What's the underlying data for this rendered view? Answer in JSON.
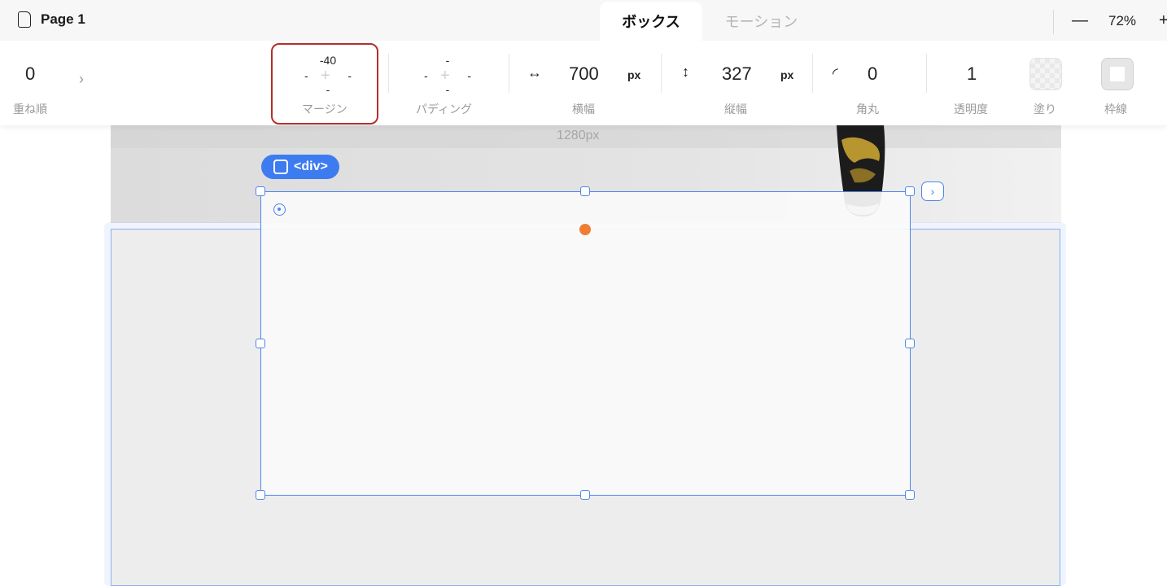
{
  "header": {
    "page_name": "Page 1",
    "tabs": [
      {
        "label": "ボックス",
        "active": true
      },
      {
        "label": "モーション",
        "active": false
      }
    ],
    "zoom": {
      "minus": "—",
      "value": "72%",
      "plus": "+"
    }
  },
  "properties": {
    "z_order": {
      "value": "0",
      "label": "重ね順",
      "chevron": "›"
    },
    "margin": {
      "top": "-40",
      "left": "-",
      "right": "-",
      "bottom": "-",
      "center": "+",
      "label": "マージン"
    },
    "padding": {
      "top": "-",
      "left": "-",
      "right": "-",
      "bottom": "-",
      "center": "+",
      "label": "パディング"
    },
    "width": {
      "icon": "↔",
      "value": "700",
      "unit": "px",
      "label": "横幅"
    },
    "height": {
      "icon": "↕",
      "value": "327",
      "unit": "px",
      "label": "縦幅"
    },
    "radius": {
      "icon": "◜",
      "value": "0",
      "label": "角丸"
    },
    "opacity": {
      "value": "1",
      "label": "透明度"
    },
    "fill": {
      "label": "塗り",
      "icon": "checker-swatch-icon"
    },
    "border": {
      "label": "枠線",
      "icon": "square-swatch-icon"
    }
  },
  "canvas": {
    "ruler_label": "1280px",
    "element_tag": "<div>",
    "expand_symbol": "›"
  },
  "colors": {
    "accent": "#3d7bf0",
    "highlight": "#b2302b",
    "handle_dot": "#ef7d33"
  }
}
